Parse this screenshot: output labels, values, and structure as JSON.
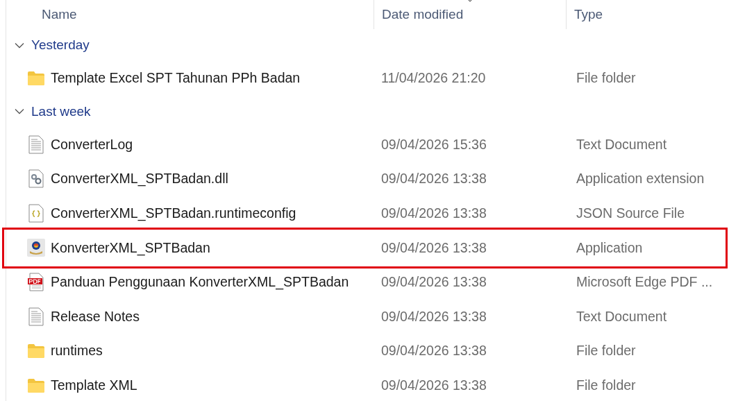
{
  "columns": [
    {
      "label": "Name",
      "sorted": false
    },
    {
      "label": "Date modified",
      "sorted": true
    },
    {
      "label": "Type",
      "sorted": false
    }
  ],
  "groups": [
    {
      "label": "Yesterday",
      "expanded": true,
      "items": [
        {
          "kind": "folder",
          "name": "Template Excel SPT Tahunan PPh Badan",
          "date": "11/04/2026 21:20",
          "type": "File folder",
          "highlighted": false
        }
      ]
    },
    {
      "label": "Last week",
      "expanded": true,
      "items": [
        {
          "kind": "text",
          "name": "ConverterLog",
          "date": "09/04/2026 15:36",
          "type": "Text Document",
          "highlighted": false
        },
        {
          "kind": "dll",
          "name": "ConverterXML_SPTBadan.dll",
          "date": "09/04/2026 13:38",
          "type": "Application extension",
          "highlighted": false
        },
        {
          "kind": "json",
          "name": "ConverterXML_SPTBadan.runtimeconfig",
          "date": "09/04/2026 13:38",
          "type": "JSON Source File",
          "highlighted": false
        },
        {
          "kind": "app",
          "name": "KonverterXML_SPTBadan",
          "date": "09/04/2026 13:38",
          "type": "Application",
          "highlighted": true
        },
        {
          "kind": "pdf",
          "name": "Panduan Penggunaan KonverterXML_SPTBadan",
          "date": "09/04/2026 13:38",
          "type": "Microsoft Edge PDF ...",
          "highlighted": false
        },
        {
          "kind": "text",
          "name": "Release Notes",
          "date": "09/04/2026 13:38",
          "type": "Text Document",
          "highlighted": false
        },
        {
          "kind": "folder",
          "name": "runtimes",
          "date": "09/04/2026 13:38",
          "type": "File folder",
          "highlighted": false
        },
        {
          "kind": "folder",
          "name": "Template XML",
          "date": "09/04/2026 13:38",
          "type": "File folder",
          "highlighted": false
        }
      ]
    }
  ]
}
